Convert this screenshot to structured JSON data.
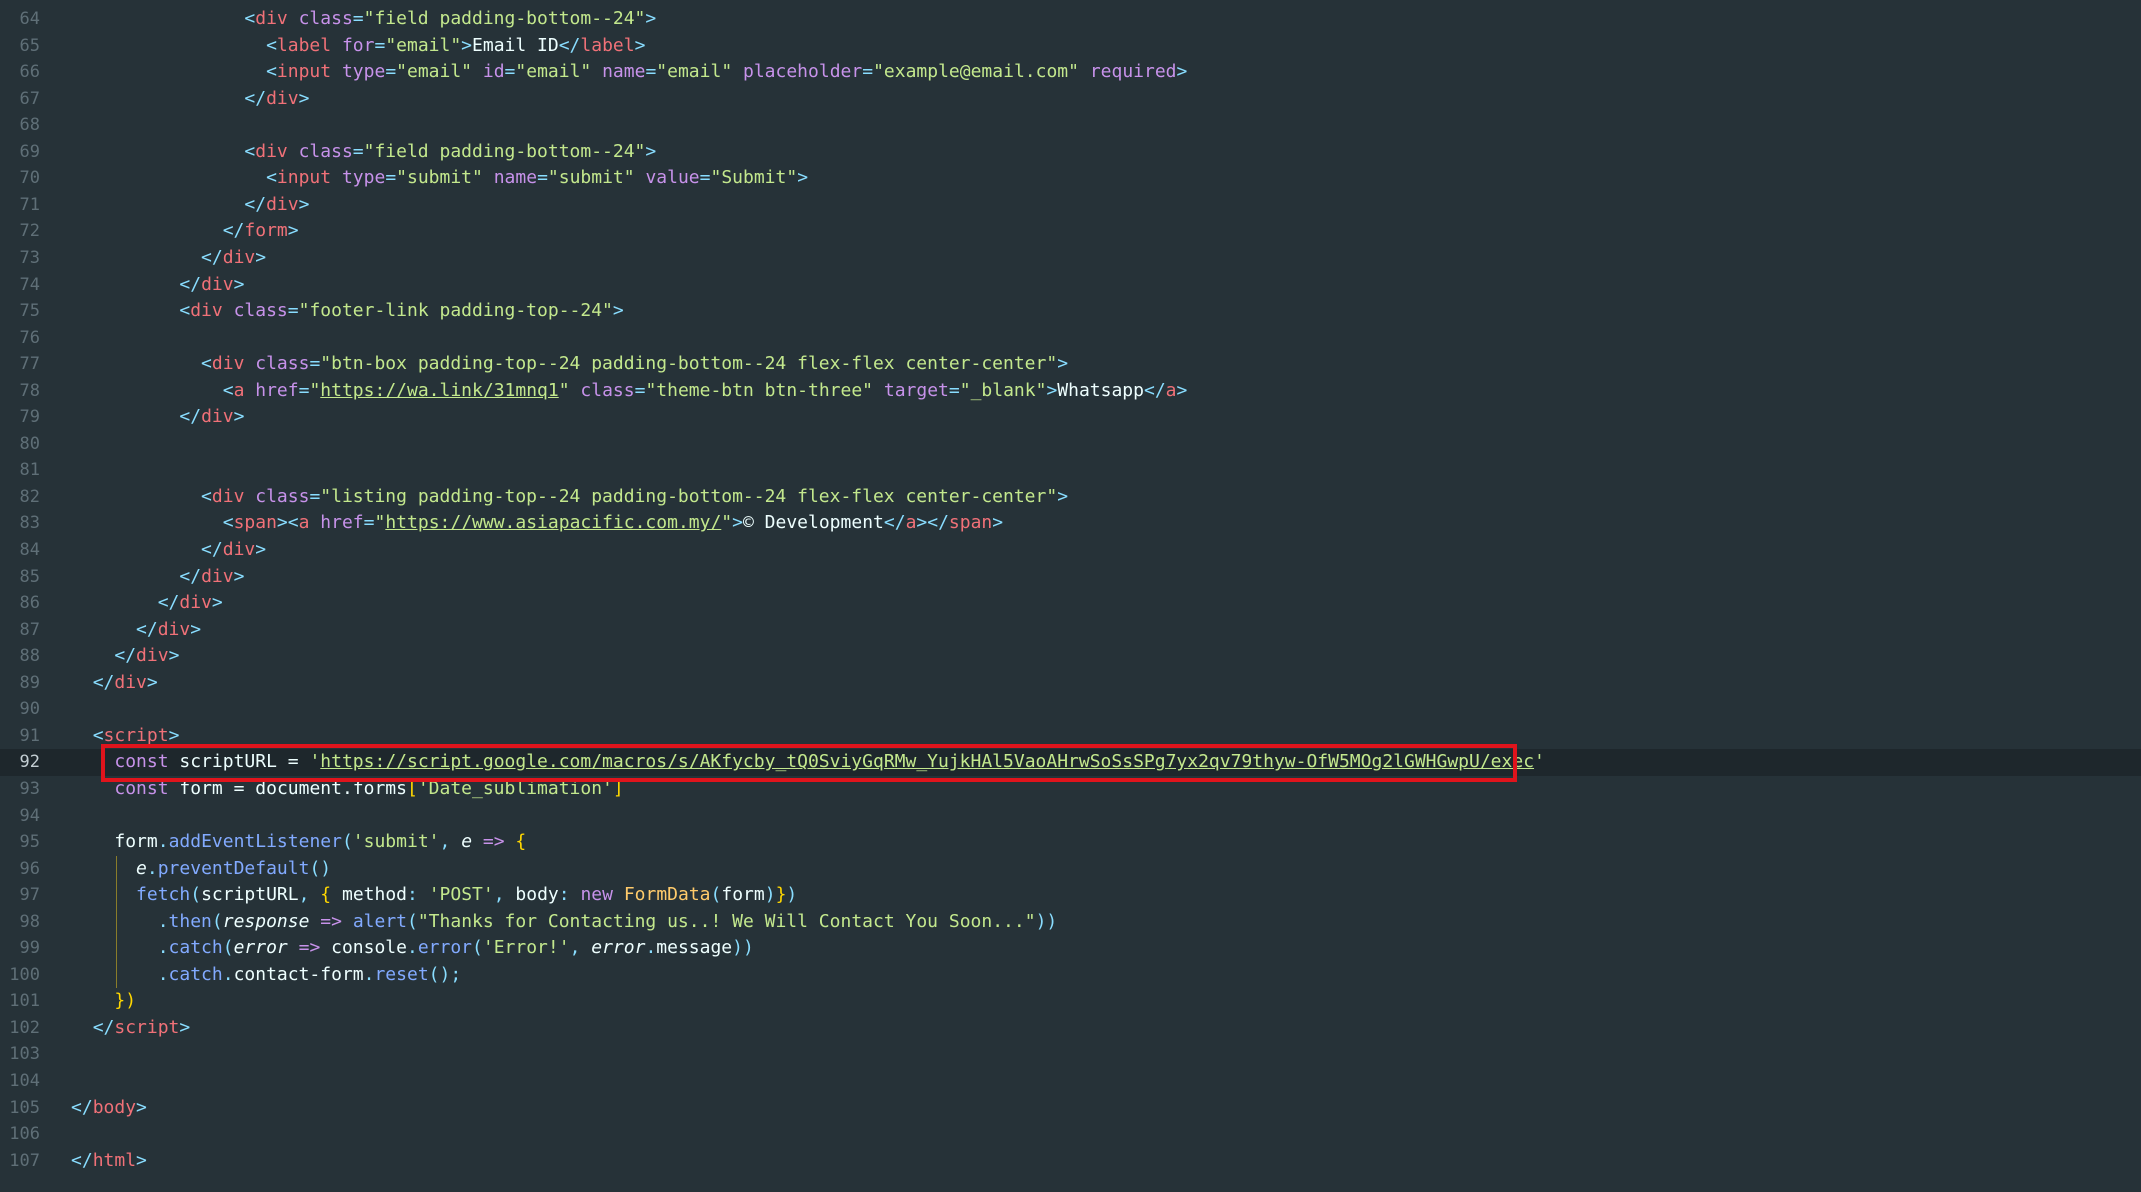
{
  "editor": {
    "accent_color": "#e0141c",
    "background_color": "#263238",
    "lines": [
      {
        "num": "64"
      },
      {
        "num": "65"
      },
      {
        "num": "66"
      },
      {
        "num": "67"
      },
      {
        "num": "68"
      },
      {
        "num": "69"
      },
      {
        "num": "70"
      },
      {
        "num": "71"
      },
      {
        "num": "72"
      },
      {
        "num": "73"
      },
      {
        "num": "74"
      },
      {
        "num": "75"
      },
      {
        "num": "76"
      },
      {
        "num": "77"
      },
      {
        "num": "78"
      },
      {
        "num": "79"
      },
      {
        "num": "80"
      },
      {
        "num": "81"
      },
      {
        "num": "82"
      },
      {
        "num": "83"
      },
      {
        "num": "84"
      },
      {
        "num": "85"
      },
      {
        "num": "86"
      },
      {
        "num": "87"
      },
      {
        "num": "88"
      },
      {
        "num": "89"
      },
      {
        "num": "90"
      },
      {
        "num": "91"
      },
      {
        "num": "92"
      },
      {
        "num": "93"
      },
      {
        "num": "94"
      },
      {
        "num": "95"
      },
      {
        "num": "96"
      },
      {
        "num": "97"
      },
      {
        "num": "98"
      },
      {
        "num": "99"
      },
      {
        "num": "100"
      },
      {
        "num": "101"
      },
      {
        "num": "102"
      },
      {
        "num": "103"
      },
      {
        "num": "104"
      },
      {
        "num": "105"
      },
      {
        "num": "106"
      },
      {
        "num": "107"
      }
    ],
    "text": {
      "div": "div",
      "label": "label",
      "input": "input",
      "form": "form",
      "a": "a",
      "span": "span",
      "script": "script",
      "body": "body",
      "html": "html",
      "class": "class",
      "for": "for",
      "type": "type",
      "id": "id",
      "name": "name",
      "placeholder": "placeholder",
      "required": "required",
      "value": "value",
      "href": "href",
      "target": "target",
      "field_pb24": "\"field padding-bottom--24\"",
      "email_q": "\"email\"",
      "email_id_label": "Email ID",
      "placeholder_value": "\"example@email.com\"",
      "submit_q": "\"submit\"",
      "submit_value_q": "\"Submit\"",
      "footer_link_class": "\"footer-link padding-top--24\"",
      "btn_box_class": "\"btn-box padding-top--24 padding-bottom--24 flex-flex center-center\"",
      "wa_url": "https://wa.link/31mnq1",
      "theme_btn_class": "\"theme-btn btn-three\"",
      "blank_q": "\"_blank\"",
      "whatsapp_text": "Whatsapp",
      "listing_class": "\"listing padding-top--24 padding-bottom--24 flex-flex center-center\"",
      "asia_url": "https://www.asiapacific.com.my/",
      "development_text": "© Development",
      "const": "const",
      "scriptURL": "scriptURL",
      "script_url_value": "https://script.google.com/macros/s/AKfycby_tQ0SviyGqRMw_YujkHAl5VaoAHrwSoSsSPg7yx2qv79thyw-OfW5MOg2lGWHGwpU/exec",
      "form_var": "form",
      "document_forms": "document.forms",
      "date_sublimation": "'Date_sublimation'",
      "addEventListener": "addEventListener",
      "submit_single": "'submit'",
      "e": "e",
      "preventDefault": "preventDefault",
      "fetch": "fetch",
      "method": "method",
      "post_single": "'POST'",
      "body_key": "body",
      "new": "new",
      "FormData": "FormData",
      "then": "then",
      "response": "response",
      "alert": "alert",
      "thanks_msg": "\"Thanks for Contacting us..! We Will Contact You Soon...\"",
      "catch": "catch",
      "error": "error",
      "console": "console",
      "error_fn": "error",
      "error_str": "'Error!'",
      "message": "message",
      "contact_form": "contact-form",
      "reset": "reset"
    }
  }
}
